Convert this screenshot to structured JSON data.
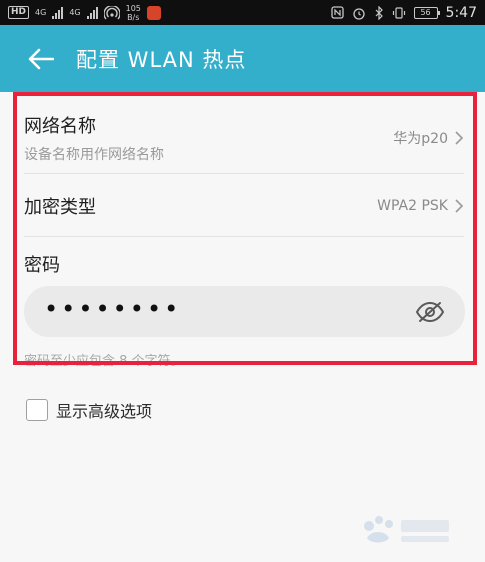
{
  "status_bar": {
    "left_tags": [
      "HD",
      "4G",
      "4G"
    ],
    "net_speed": [
      "105",
      "B/s"
    ],
    "battery": "56",
    "time": "5:47"
  },
  "header": {
    "title": "配置 WLAN 热点",
    "back_icon": "arrow-left-icon"
  },
  "settings": {
    "network_name": {
      "title": "网络名称",
      "subtitle": "设备名称用作网络名称",
      "value": "华为p20"
    },
    "encryption": {
      "title": "加密类型",
      "value": "WPA2 PSK"
    },
    "password": {
      "title": "密码",
      "value": "••••••••",
      "toggle_icon": "eye-off-icon",
      "hint": "密码至少应包含 8 个字符。"
    },
    "advanced": {
      "label": "显示高级选项",
      "checked": false
    }
  },
  "colors": {
    "app_bar": "#33aecb",
    "highlight": "#e8223b"
  }
}
